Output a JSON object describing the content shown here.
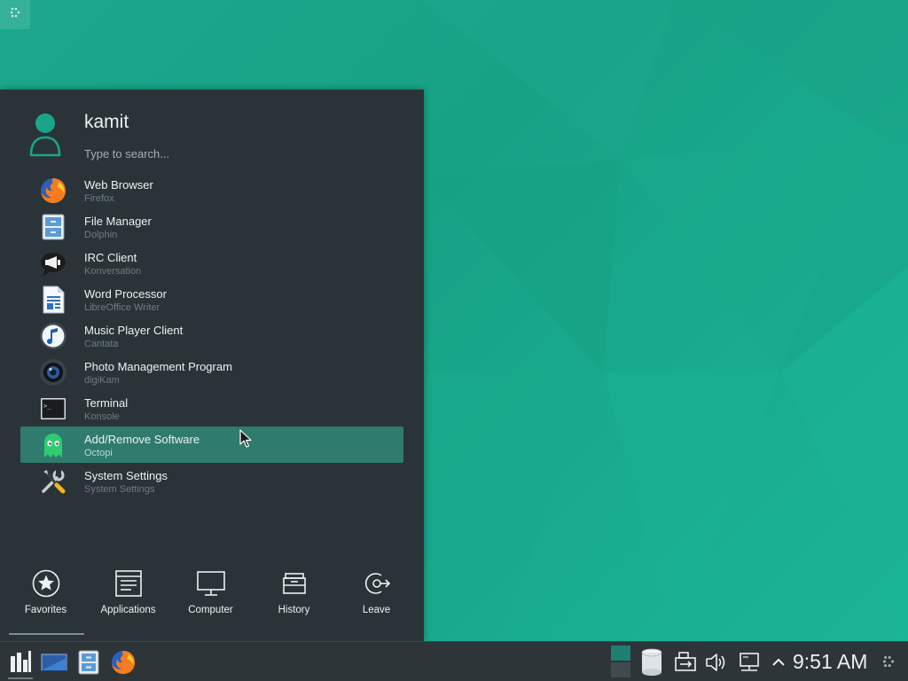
{
  "user": {
    "name": "kamit"
  },
  "search": {
    "placeholder": "Type to search..."
  },
  "apps": [
    {
      "name": "Web Browser",
      "generic": "Firefox",
      "icon": "firefox-icon",
      "highlighted": false
    },
    {
      "name": "File Manager",
      "generic": "Dolphin",
      "icon": "file-manager-icon",
      "highlighted": false
    },
    {
      "name": "IRC Client",
      "generic": "Konversation",
      "icon": "irc-chat-icon",
      "highlighted": false
    },
    {
      "name": "Word Processor",
      "generic": "LibreOffice Writer",
      "icon": "document-icon",
      "highlighted": false
    },
    {
      "name": "Music Player Client",
      "generic": "Cantata",
      "icon": "music-note-icon",
      "highlighted": false
    },
    {
      "name": "Photo Management Program",
      "generic": "digiKam",
      "icon": "camera-lens-icon",
      "highlighted": false
    },
    {
      "name": "Terminal",
      "generic": "Konsole",
      "icon": "terminal-icon",
      "highlighted": false
    },
    {
      "name": "Add/Remove Software",
      "generic": "Octopi",
      "icon": "ghost-icon",
      "highlighted": true
    },
    {
      "name": "System Settings",
      "generic": "System Settings",
      "icon": "tools-icon",
      "highlighted": false
    }
  ],
  "tabs": [
    {
      "label": "Favorites",
      "icon": "star-icon",
      "active": true
    },
    {
      "label": "Applications",
      "icon": "applications-window-icon",
      "active": false
    },
    {
      "label": "Computer",
      "icon": "monitor-icon",
      "active": false
    },
    {
      "label": "History",
      "icon": "archive-box-icon",
      "active": false
    },
    {
      "label": "Leave",
      "icon": "logout-icon",
      "active": false
    }
  ],
  "taskbar": {
    "launchers": [
      {
        "icon": "application-launcher-icon"
      },
      {
        "icon": "desktop-icon"
      },
      {
        "icon": "file-manager-icon"
      },
      {
        "icon": "firefox-icon"
      }
    ],
    "pager": {
      "desktops": 2,
      "current": 1
    },
    "tray": [
      {
        "icon": "disk-icon"
      },
      {
        "icon": "usb-icon"
      },
      {
        "icon": "volume-icon"
      },
      {
        "icon": "network-icon"
      },
      {
        "icon": "chevron-up-icon"
      }
    ],
    "clock": "9:51 AM"
  },
  "colors": {
    "accent": "#1aa589",
    "panel": "#2a3438",
    "highlight": "#2f7b6d",
    "taskbar": "#2d3538"
  }
}
